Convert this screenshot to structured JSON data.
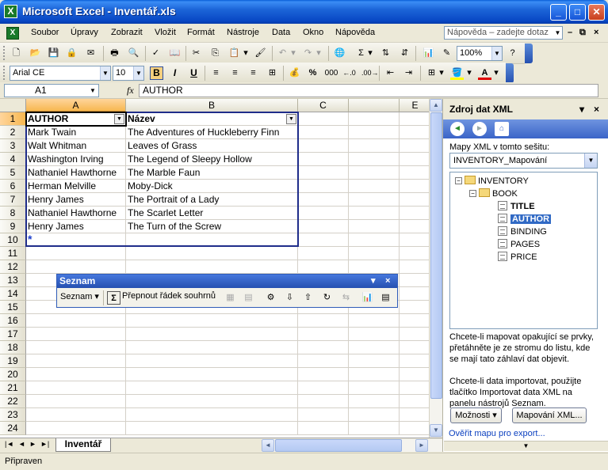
{
  "window": {
    "title": "Microsoft Excel - Inventář.xls",
    "minimize": "_",
    "maximize": "□",
    "close": "✕"
  },
  "menu": {
    "items": [
      "Soubor",
      "Úpravy",
      "Zobrazit",
      "Vložit",
      "Formát",
      "Nástroje",
      "Data",
      "Okno",
      "Nápověda"
    ],
    "help_placeholder": "Nápověda – zadejte dotaz",
    "doc_controls": {
      "minimize": "–",
      "restore": "⧉",
      "close": "×"
    }
  },
  "toolbar_standard": {
    "zoom": "100%"
  },
  "toolbar_formatting": {
    "font": "Arial CE",
    "size": "10",
    "bold": "B",
    "italic": "I",
    "underline": "U",
    "percent": "%",
    "thousands": "000"
  },
  "formula_bar": {
    "name_box": "A1",
    "fx": "fx",
    "value": "AUTHOR"
  },
  "grid": {
    "columns": [
      "A",
      "B",
      "C",
      "E"
    ],
    "rows": [
      "1",
      "2",
      "3",
      "4",
      "5",
      "6",
      "7",
      "8",
      "9",
      "10",
      "11",
      "12",
      "13",
      "14",
      "15",
      "16",
      "17",
      "18",
      "19",
      "20",
      "21",
      "22",
      "23",
      "24"
    ],
    "header": [
      "AUTHOR",
      "Název"
    ],
    "data": [
      [
        "Mark Twain",
        "The Adventures of Huckleberry Finn"
      ],
      [
        "Walt Whitman",
        "Leaves of Grass"
      ],
      [
        "Washington Irving",
        "The Legend of Sleepy Hollow"
      ],
      [
        "Nathaniel Hawthorne",
        "The Marble Faun"
      ],
      [
        "Herman Melville",
        "Moby-Dick"
      ],
      [
        "Henry James",
        "The Portrait of a Lady"
      ],
      [
        "Nathaniel Hawthorne",
        "The Scarlet Letter"
      ],
      [
        "Henry James",
        "The Turn of the Screw"
      ]
    ],
    "insert_row_marker": "*"
  },
  "sheet_tabs": {
    "active": "Inventář",
    "nav": [
      "|◄",
      "◄",
      "►",
      "►|"
    ]
  },
  "status": {
    "text": "Připraven"
  },
  "list_toolbar": {
    "title": "Seznam",
    "menu_label": "Seznam ▾",
    "toggle_total": "Přepnout řádek souhrnů",
    "controls": {
      "menu": "▾",
      "close": "×"
    }
  },
  "task_pane": {
    "title": "Zdroj dat XML",
    "controls": {
      "menu": "▾",
      "close": "×"
    },
    "maps_label": "Mapy XML v tomto sešitu:",
    "selected_map": "INVENTORY_Mapování",
    "tree": {
      "root": "INVENTORY",
      "book": "BOOK",
      "fields": [
        "TITLE",
        "AUTHOR",
        "BINDING",
        "PAGES",
        "PRICE"
      ],
      "selected": "AUTHOR"
    },
    "help_text_1": "Chcete-li mapovat opakující se prvky, přetáhněte je ze stromu do listu, kde se mají tato záhlaví dat objevit.",
    "help_text_2": "Chcete-li data importovat, použijte tlačítko Importovat data XML na panelu nástrojů Seznam.",
    "options_button": "Možnosti ▾",
    "mapping_button": "Mapování XML...",
    "verify_link": "Ověřit mapu pro export..."
  },
  "colors": {
    "title_bar": "#0a5fd8",
    "list_border": "#1f2d8a",
    "selected_header": "#f7b750",
    "tree_selection": "#316ac5",
    "link": "#0a3fbf"
  }
}
